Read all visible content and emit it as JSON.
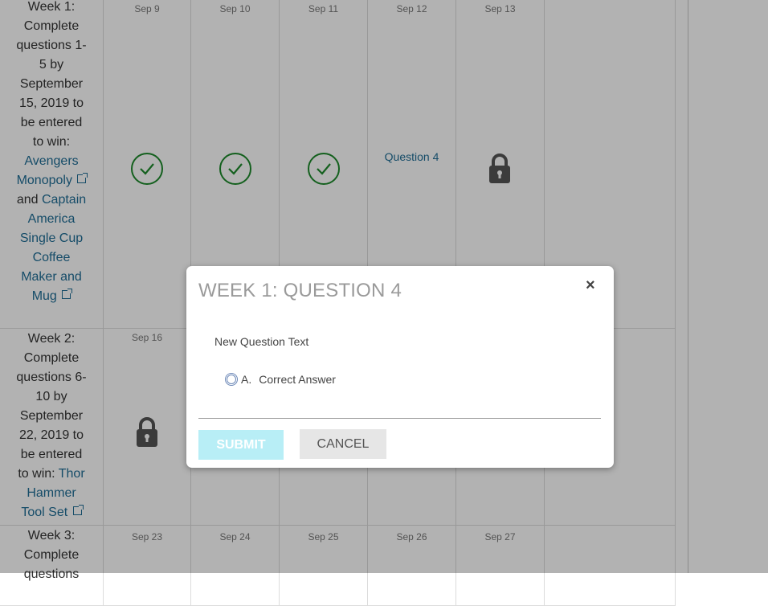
{
  "weeks": [
    {
      "prefix": "Week 1: Complete questions 1-5 by September 15, 2019 to be entered to win: ",
      "prize1": "Avengers Monopoly",
      "and": "and",
      "prize2": "Captain America Single Cup Coffee Maker and Mug",
      "dates": [
        "Sep 9",
        "Sep 10",
        "Sep 11",
        "Sep 12",
        "Sep 13"
      ],
      "statuses": [
        "completed",
        "completed",
        "completed",
        "available",
        "locked"
      ],
      "question_link": "Question 4"
    },
    {
      "prefix": "Week 2: Complete questions 6-10 by September 22, 2019 to be entered to win: ",
      "prize1": "Thor Hammer Tool Set",
      "dates": [
        "Sep 16"
      ],
      "statuses": [
        "locked"
      ]
    },
    {
      "prefix": "Week 3: Complete questions",
      "dates": [
        "Sep 23",
        "Sep 24",
        "Sep 25",
        "Sep 26",
        "Sep 27"
      ]
    }
  ],
  "modal": {
    "title": "WEEK 1: QUESTION 4",
    "close_icon": "×",
    "question_text": "New Question Text",
    "answer_letter": "A.",
    "answer_text": "Correct Answer",
    "submit_label": "SUBMIT",
    "cancel_label": "CANCEL"
  },
  "colors": {
    "link": "#1f6d96",
    "check": "#1e8a2c",
    "submit_bg": "#b8eef6"
  }
}
